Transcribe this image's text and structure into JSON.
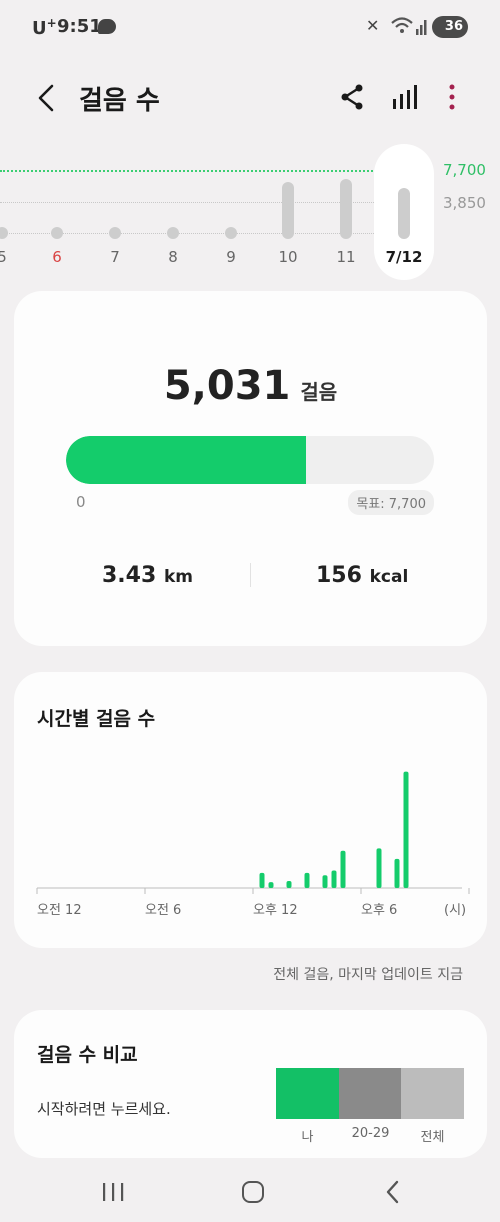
{
  "status_bar": {
    "carrier": "U",
    "carrier_plus": "+",
    "time": "9:51",
    "battery": "36"
  },
  "app_bar": {
    "title": "걸음 수",
    "icons": [
      "back-arrow-icon",
      "share-icon",
      "bar-chart-icon",
      "more-vert-icon"
    ]
  },
  "daily_strip": {
    "goal_label": "7,700",
    "mid_label": "3,850",
    "days": [
      {
        "label": "5",
        "level": 0,
        "red": false,
        "selected": false
      },
      {
        "label": "6",
        "level": 0,
        "red": true,
        "selected": false
      },
      {
        "label": "7",
        "level": 0,
        "red": false,
        "selected": false
      },
      {
        "label": "8",
        "level": 0,
        "red": false,
        "selected": false
      },
      {
        "label": "9",
        "level": 0.02,
        "red": false,
        "selected": false
      },
      {
        "label": "10",
        "level": 0.55,
        "red": false,
        "selected": false
      },
      {
        "label": "11",
        "level": 0.58,
        "red": false,
        "selected": false
      },
      {
        "label": "7/12",
        "level": 0.5,
        "red": false,
        "selected": true
      }
    ]
  },
  "summary": {
    "steps": "5,031",
    "steps_unit": "걸음",
    "progress_fraction": 0.653,
    "progress_start": "0",
    "goal_label": "목표: 7,700",
    "distance_value": "3.43",
    "distance_unit": "km",
    "calories_value": "156",
    "calories_unit": "kcal"
  },
  "hourly": {
    "title": "시간별 걸음 수",
    "x_labels": [
      "오전 12",
      "오전 6",
      "오후 12",
      "오후 6",
      "(시)"
    ],
    "accent": "#14cc6b"
  },
  "chart_data": {
    "type": "bar",
    "title": "시간별 걸음 수",
    "xlabel": "(시)",
    "categories": [
      "12.5",
      "13",
      "14",
      "15",
      "16",
      "16.5",
      "17",
      "19",
      "20",
      "20.5",
      "22"
    ],
    "values": [
      130,
      50,
      60,
      130,
      110,
      150,
      320,
      340,
      250,
      1000,
      0
    ],
    "ylim": [
      0,
      1100
    ]
  },
  "footnote": "전체 걸음, 마지막 업데이트 지금",
  "compare": {
    "title": "걸음 수 비교",
    "subtitle": "시작하려면 누르세요.",
    "groups": [
      {
        "label": "나",
        "color": "#13c066"
      },
      {
        "label": "20-29",
        "color": "#8a8a8a"
      },
      {
        "label": "전체",
        "color": "#bcbcbc"
      }
    ]
  }
}
